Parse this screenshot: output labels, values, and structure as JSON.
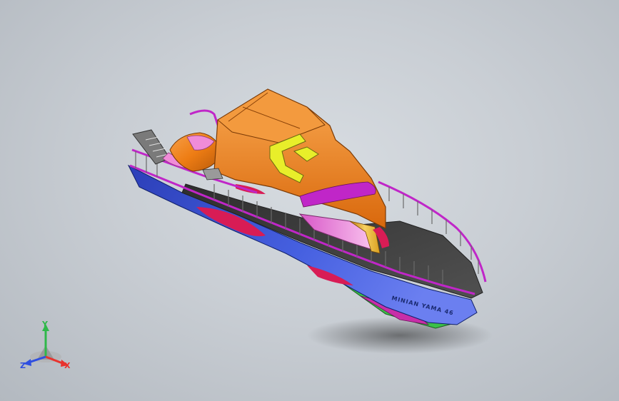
{
  "model": {
    "hull_name_text": "MINIAN YAMA 46"
  },
  "triad": {
    "x_label": "X",
    "y_label": "Y",
    "z_label": "Z",
    "x_color": "#e8332e",
    "y_color": "#2fb84a",
    "z_color": "#2f4fe0"
  },
  "colors": {
    "background": "#c9ced4",
    "cabin_orange": "#f07e16",
    "rail_magenta": "#c026c8",
    "hull_blue": "#3a52d6",
    "deck_dark": "#3e3e3e",
    "accent_yellow": "#e8ee2a",
    "accent_pink": "#f08cd8",
    "keel_green": "#3bc048",
    "hull_red": "#d81c55"
  }
}
